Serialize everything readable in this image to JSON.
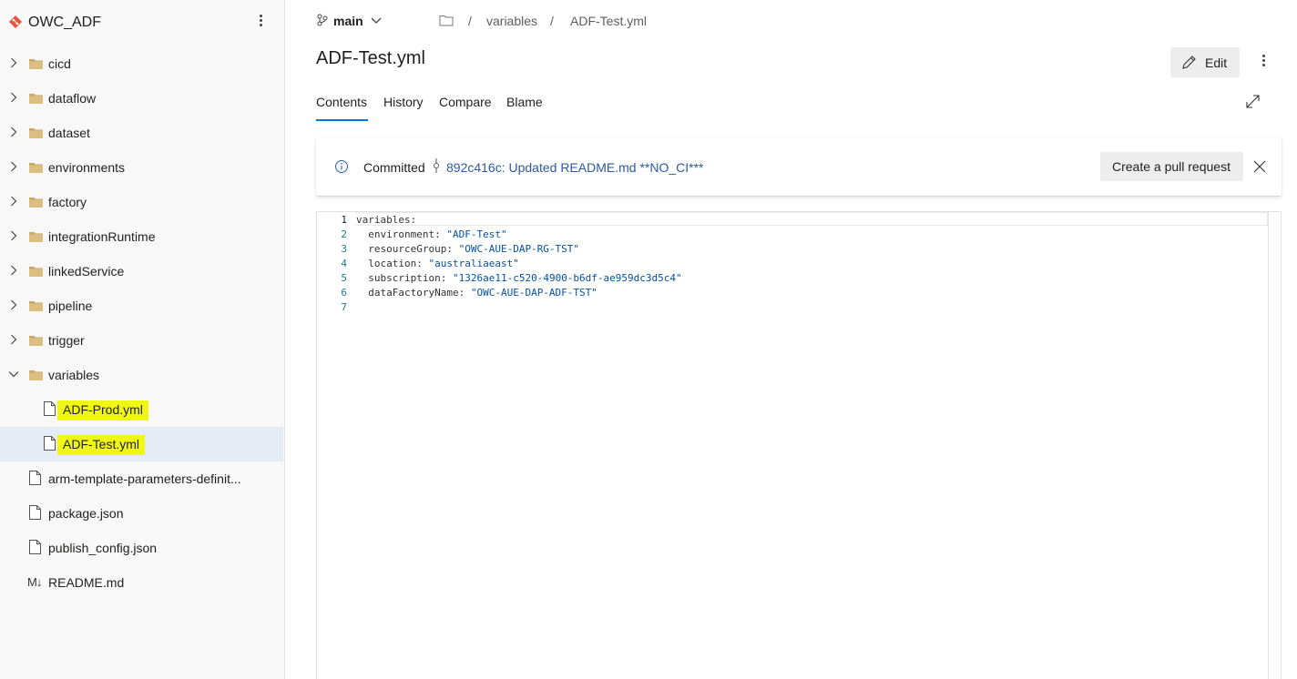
{
  "repo": {
    "name": "OWC_ADF"
  },
  "tree": [
    {
      "type": "folder",
      "label": "cicd",
      "expanded": false
    },
    {
      "type": "folder",
      "label": "dataflow",
      "expanded": false
    },
    {
      "type": "folder",
      "label": "dataset",
      "expanded": false
    },
    {
      "type": "folder",
      "label": "environments",
      "expanded": false
    },
    {
      "type": "folder",
      "label": "factory",
      "expanded": false
    },
    {
      "type": "folder",
      "label": "integrationRuntime",
      "expanded": false
    },
    {
      "type": "folder",
      "label": "linkedService",
      "expanded": false
    },
    {
      "type": "folder",
      "label": "pipeline",
      "expanded": false
    },
    {
      "type": "folder",
      "label": "trigger",
      "expanded": false
    },
    {
      "type": "folder",
      "label": "variables",
      "expanded": true
    },
    {
      "type": "file",
      "label": "ADF-Prod.yml",
      "highlighted": true
    },
    {
      "type": "file",
      "label": "ADF-Test.yml",
      "highlighted": true,
      "selected": true
    },
    {
      "type": "file",
      "label": "arm-template-parameters-definit..."
    },
    {
      "type": "file",
      "label": "package.json"
    },
    {
      "type": "file",
      "label": "publish_config.json"
    },
    {
      "type": "markdown",
      "label": "README.md",
      "icon_text": "M↓"
    }
  ],
  "topbar": {
    "branch": "main",
    "breadcrumb": {
      "sep": "/",
      "items": [
        "variables",
        "ADF-Test.yml"
      ]
    }
  },
  "file": {
    "title": "ADF-Test.yml"
  },
  "actions": {
    "edit_label": "Edit"
  },
  "tabs": [
    "Contents",
    "History",
    "Compare",
    "Blame"
  ],
  "banner": {
    "committed_label": "Committed",
    "commit_text": "892c416c: Updated README.md **NO_CI***",
    "pr_button": "Create a pull request"
  },
  "code": {
    "lines": [
      {
        "n": "1",
        "key": "variables",
        "value": "",
        "indent": ""
      },
      {
        "n": "2",
        "key": "environment",
        "value": "\"ADF-Test\"",
        "indent": "  "
      },
      {
        "n": "3",
        "key": "resourceGroup",
        "value": "\"OWC-AUE-DAP-RG-TST\"",
        "indent": "  "
      },
      {
        "n": "4",
        "key": "location",
        "value": "\"australiaeast\"",
        "indent": "  "
      },
      {
        "n": "5",
        "key": "subscription",
        "value": "\"1326ae11-c520-4900-b6df-ae959dc3d5c4\"",
        "indent": "  "
      },
      {
        "n": "6",
        "key": "dataFactoryName",
        "value": "\"OWC-AUE-DAP-ADF-TST\"",
        "indent": "  "
      },
      {
        "n": "7",
        "key": "",
        "value": "",
        "indent": ""
      }
    ]
  },
  "colors": {
    "accent": "#0078d4",
    "link": "#2b5aa3",
    "highlight": "#f0f715",
    "selected_row": "#e6ecf6"
  }
}
